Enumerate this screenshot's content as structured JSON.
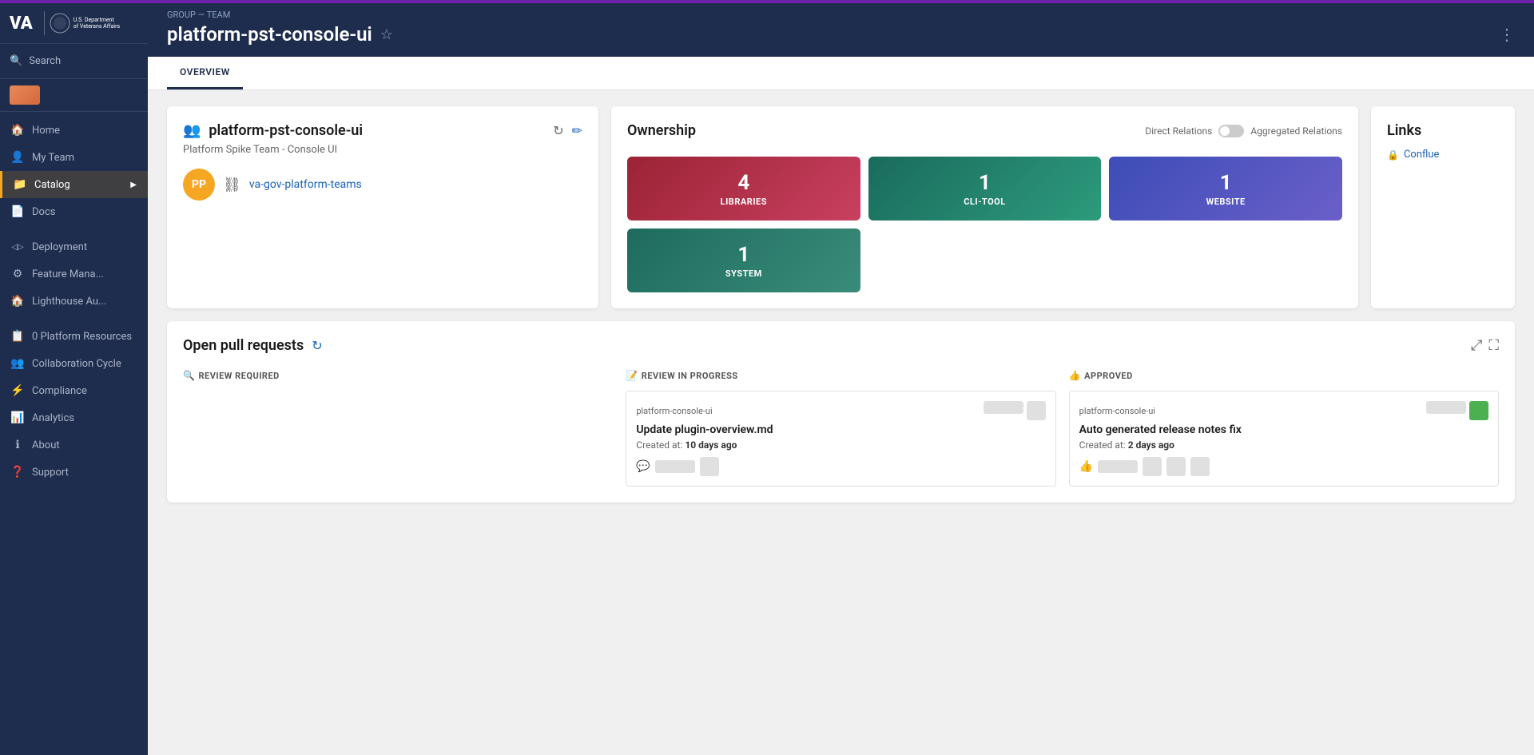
{
  "topbar": {
    "purple_bar": true
  },
  "sidebar": {
    "logo": {
      "va_text": "VA",
      "dept_line1": "U.S. Department",
      "dept_line2": "of Veterans Affairs"
    },
    "search_label": "Search",
    "nav_items": [
      {
        "id": "home",
        "label": "Home",
        "icon": "🏠",
        "active": false
      },
      {
        "id": "my-team",
        "label": "My Team",
        "icon": "👤",
        "active": false
      },
      {
        "id": "catalog",
        "label": "Catalog",
        "icon": "📁",
        "active": true,
        "has_arrow": true
      },
      {
        "id": "docs",
        "label": "Docs",
        "icon": "📄",
        "active": false
      }
    ],
    "expandable_items": [
      {
        "id": "deployment",
        "label": "Deployment",
        "icon": "◁▷",
        "active": false
      },
      {
        "id": "feature-mana",
        "label": "Feature Mana...",
        "icon": "⚙",
        "active": false
      },
      {
        "id": "lighthouse-au",
        "label": "Lighthouse Au...",
        "icon": "🏠",
        "active": false
      }
    ],
    "bottom_items": [
      {
        "id": "platform-resources",
        "label": "0 Platform Resources",
        "icon": "📋",
        "active": false
      },
      {
        "id": "collaboration-cycle",
        "label": "Collaboration Cycle",
        "icon": "👥",
        "active": false
      },
      {
        "id": "compliance",
        "label": "Compliance",
        "icon": "⚡",
        "active": false
      },
      {
        "id": "analytics",
        "label": "Analytics",
        "icon": "📊",
        "active": false
      },
      {
        "id": "about",
        "label": "About",
        "icon": "ℹ",
        "active": false
      },
      {
        "id": "support",
        "label": "Support",
        "icon": "❓",
        "active": false
      }
    ]
  },
  "header": {
    "breadcrumb": "GROUP — TEAM",
    "title": "platform-pst-console-ui",
    "more_icon": "⋮"
  },
  "tabs": [
    {
      "id": "overview",
      "label": "OVERVIEW",
      "active": true
    }
  ],
  "team_card": {
    "title": "platform-pst-console-ui",
    "subtitle": "Platform Spike Team - Console UI",
    "member_initials": "PP",
    "member_link": "va-gov-platform-teams",
    "refresh_icon": "↻",
    "edit_icon": "✏"
  },
  "ownership": {
    "title": "Ownership",
    "direct_relations": "Direct Relations",
    "aggregated_relations": "Aggregated Relations",
    "tiles": [
      {
        "id": "libraries",
        "count": "4",
        "label": "LIBRARIES",
        "class": "tile-libraries"
      },
      {
        "id": "cli-tool",
        "count": "1",
        "label": "CLI-TOOL",
        "class": "tile-cli"
      },
      {
        "id": "website",
        "count": "1",
        "label": "WEBSITE",
        "class": "tile-website"
      },
      {
        "id": "system",
        "count": "1",
        "label": "SYSTEM",
        "class": "tile-system"
      }
    ]
  },
  "links": {
    "title": "Links",
    "items": [
      {
        "id": "conflue",
        "label": "Conflue",
        "icon": "🔒"
      }
    ]
  },
  "pull_requests": {
    "title": "Open pull requests",
    "columns": [
      {
        "id": "review-required",
        "emoji": "🔍",
        "label": "REVIEW REQUIRED",
        "cards": []
      },
      {
        "id": "review-in-progress",
        "emoji": "📝",
        "label": "REVIEW IN PROGRESS",
        "cards": [
          {
            "repo": "platform-console-ui",
            "pr_title": "Update plugin-overview.md",
            "created_label": "Created at:",
            "created_value": "10 days ago",
            "has_comment": true
          }
        ]
      },
      {
        "id": "approved",
        "emoji": "👍",
        "label": "APPROVED",
        "cards": [
          {
            "repo": "platform-console-ui",
            "pr_title": "Auto generated release notes fix",
            "created_label": "Created at:",
            "created_value": "2 days ago",
            "has_comment": true
          }
        ]
      }
    ]
  }
}
